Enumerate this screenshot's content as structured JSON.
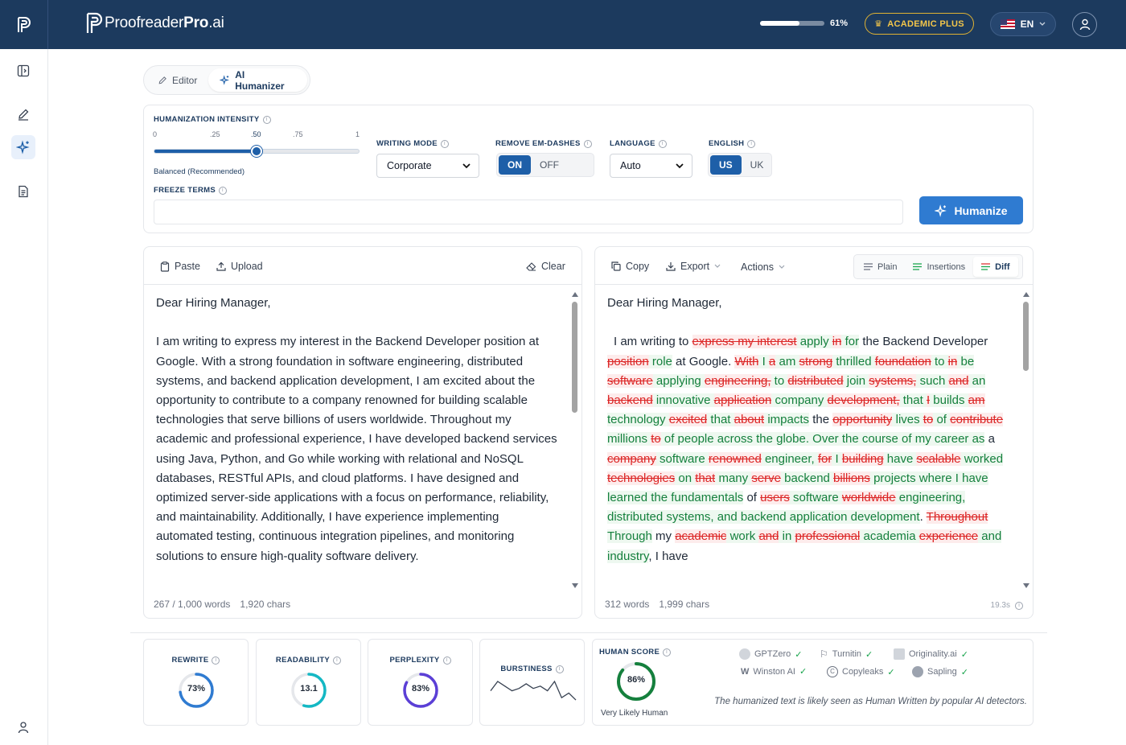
{
  "header": {
    "brand_light": "Proofreader",
    "brand_bold": "Pro",
    "brand_suffix": ".ai",
    "usage_percent": 61,
    "usage_label": "61%",
    "plan_badge": "ACADEMIC PLUS",
    "language": "EN"
  },
  "sidebar": {
    "items": [
      "panel-toggle-icon",
      "pen-icon",
      "sparkle-icon",
      "document-icon",
      "user-icon"
    ],
    "active": "sparkle-icon"
  },
  "tabs": [
    {
      "label": "Editor",
      "icon": "pen-icon",
      "active": false
    },
    {
      "label": "AI Humanizer",
      "icon": "sparkle-icon",
      "active": true
    }
  ],
  "settings": {
    "intensity_label": "HUMANIZATION INTENSITY",
    "ticks": [
      "0",
      ".25",
      ".50",
      ".75",
      "1"
    ],
    "intensity_value": 0.5,
    "intensity_caption": "Balanced (Recommended)",
    "writing_mode_label": "WRITING MODE",
    "writing_mode_value": "Corporate",
    "em_dash_label": "REMOVE EM-DASHES",
    "em_dash_on": "ON",
    "em_dash_off": "OFF",
    "language_label": "LANGUAGE",
    "language_value": "Auto",
    "english_label": "ENGLISH",
    "english_us": "US",
    "english_uk": "UK",
    "freeze_label": "FREEZE TERMS",
    "freeze_value": "",
    "humanize_button": "Humanize"
  },
  "input_panel": {
    "paste": "Paste",
    "upload": "Upload",
    "clear": "Clear",
    "greeting": "Dear Hiring Manager,",
    "body": "I am writing to express my interest in the Backend Developer position at Google. With a strong foundation in software engineering, distributed systems, and backend application development, I am excited about the opportunity to contribute to a company renowned for building scalable technologies that serve billions of users worldwide. Throughout my academic and professional experience, I have developed backend services using Java, Python, and Go while working with relational and NoSQL databases, RESTful APIs, and cloud platforms. I have designed and optimized server-side applications with a focus on performance, reliability, and maintainability. Additionally, I have experience implementing automated testing, continuous integration pipelines, and monitoring solutions to ensure high-quality software delivery.",
    "word_count": "267 / 1,000 words",
    "char_count": "1,920 chars"
  },
  "output_panel": {
    "copy": "Copy",
    "export": "Export",
    "actions": "Actions",
    "view_plain": "Plain",
    "view_insertions": "Insertions",
    "view_diff": "Diff",
    "greeting": "Dear Hiring Manager,",
    "diff_tokens": [
      {
        "t": "I am writing to ",
        "k": "n"
      },
      {
        "t": "express my interest",
        "k": "d"
      },
      {
        "t": " apply ",
        "k": "i"
      },
      {
        "t": "in",
        "k": "d"
      },
      {
        "t": " for",
        "k": "i"
      },
      {
        "t": " the Backend Developer ",
        "k": "n"
      },
      {
        "t": "position",
        "k": "d"
      },
      {
        "t": " role",
        "k": "i"
      },
      {
        "t": " at Google. ",
        "k": "n"
      },
      {
        "t": "With",
        "k": "d"
      },
      {
        "t": " I ",
        "k": "i"
      },
      {
        "t": "a",
        "k": "d"
      },
      {
        "t": " am ",
        "k": "i"
      },
      {
        "t": "strong",
        "k": "d"
      },
      {
        "t": " thrilled ",
        "k": "i"
      },
      {
        "t": "foundation",
        "k": "d"
      },
      {
        "t": " to ",
        "k": "i"
      },
      {
        "t": "in",
        "k": "d"
      },
      {
        "t": " be ",
        "k": "i"
      },
      {
        "t": "software",
        "k": "d"
      },
      {
        "t": " applying ",
        "k": "i"
      },
      {
        "t": "engineering,",
        "k": "d"
      },
      {
        "t": " to ",
        "k": "i"
      },
      {
        "t": "distributed",
        "k": "d"
      },
      {
        "t": " join ",
        "k": "i"
      },
      {
        "t": "systems,",
        "k": "d"
      },
      {
        "t": " such ",
        "k": "i"
      },
      {
        "t": "and",
        "k": "d"
      },
      {
        "t": " an ",
        "k": "i"
      },
      {
        "t": "backend",
        "k": "d"
      },
      {
        "t": " innovative ",
        "k": "i"
      },
      {
        "t": "application",
        "k": "d"
      },
      {
        "t": " company ",
        "k": "i"
      },
      {
        "t": "development,",
        "k": "d"
      },
      {
        "t": " that ",
        "k": "i"
      },
      {
        "t": "I",
        "k": "d"
      },
      {
        "t": " builds ",
        "k": "i"
      },
      {
        "t": "am",
        "k": "d"
      },
      {
        "t": " technology ",
        "k": "i"
      },
      {
        "t": "excited",
        "k": "d"
      },
      {
        "t": " that ",
        "k": "i"
      },
      {
        "t": "about",
        "k": "d"
      },
      {
        "t": " impacts",
        "k": "i"
      },
      {
        "t": " the ",
        "k": "n"
      },
      {
        "t": "opportunity",
        "k": "d"
      },
      {
        "t": " lives ",
        "k": "i"
      },
      {
        "t": "to",
        "k": "d"
      },
      {
        "t": " of ",
        "k": "i"
      },
      {
        "t": "contribute",
        "k": "d"
      },
      {
        "t": " millions ",
        "k": "i"
      },
      {
        "t": "to",
        "k": "d"
      },
      {
        "t": " of people across the globe. Over the course of my career as",
        "k": "i"
      },
      {
        "t": " a ",
        "k": "n"
      },
      {
        "t": "company",
        "k": "d"
      },
      {
        "t": " software ",
        "k": "i"
      },
      {
        "t": "renowned",
        "k": "d"
      },
      {
        "t": " engineer, ",
        "k": "i"
      },
      {
        "t": "for",
        "k": "d"
      },
      {
        "t": " I ",
        "k": "i"
      },
      {
        "t": "building",
        "k": "d"
      },
      {
        "t": " have ",
        "k": "i"
      },
      {
        "t": "scalable",
        "k": "d"
      },
      {
        "t": " worked ",
        "k": "i"
      },
      {
        "t": "technologies",
        "k": "d"
      },
      {
        "t": " on ",
        "k": "i"
      },
      {
        "t": "that",
        "k": "d"
      },
      {
        "t": " many ",
        "k": "i"
      },
      {
        "t": "serve",
        "k": "d"
      },
      {
        "t": " backend ",
        "k": "i"
      },
      {
        "t": "billions",
        "k": "d"
      },
      {
        "t": " projects where I have learned the fundamentals",
        "k": "i"
      },
      {
        "t": " of ",
        "k": "n"
      },
      {
        "t": "users",
        "k": "d"
      },
      {
        "t": " software ",
        "k": "i"
      },
      {
        "t": "worldwide",
        "k": "d"
      },
      {
        "t": " engineering, distributed systems, and backend application development",
        "k": "i"
      },
      {
        "t": ". ",
        "k": "n"
      },
      {
        "t": "Throughout",
        "k": "d"
      },
      {
        "t": " Through",
        "k": "i"
      },
      {
        "t": " my ",
        "k": "n"
      },
      {
        "t": "academic",
        "k": "d"
      },
      {
        "t": " work ",
        "k": "i"
      },
      {
        "t": "and",
        "k": "d"
      },
      {
        "t": " in ",
        "k": "i"
      },
      {
        "t": "professional",
        "k": "d"
      },
      {
        "t": " academia ",
        "k": "i"
      },
      {
        "t": "experience",
        "k": "d"
      },
      {
        "t": " and industry",
        "k": "i"
      },
      {
        "t": ", I have ",
        "k": "n"
      }
    ],
    "word_count": "312 words",
    "char_count": "1,999 chars",
    "elapsed": "19.3s"
  },
  "metrics": {
    "rewrite": {
      "label": "REWRITE",
      "value": "73%",
      "fraction": 0.73,
      "color": "#2f7bd1"
    },
    "readability": {
      "label": "READABILITY",
      "value": "13.1",
      "fraction": 0.55,
      "color": "#14b8c4"
    },
    "perplexity": {
      "label": "PERPLEXITY",
      "value": "83%",
      "fraction": 0.83,
      "color": "#5b3fd6"
    },
    "burstiness": {
      "label": "BURSTINESS",
      "series": [
        5,
        9,
        7,
        5,
        6,
        8,
        6,
        7,
        5,
        9,
        2,
        4,
        1
      ]
    },
    "human_score": {
      "label": "HUMAN SCORE",
      "value": "86%",
      "fraction": 0.86,
      "color": "#15803d",
      "caption": "Very Likely Human"
    },
    "detectors": [
      "GPTZero",
      "Turnitin",
      "Originality.ai",
      "Winston AI",
      "Copyleaks",
      "Sapling"
    ],
    "note": "The humanized text is likely seen as Human Written by popular AI detectors."
  }
}
